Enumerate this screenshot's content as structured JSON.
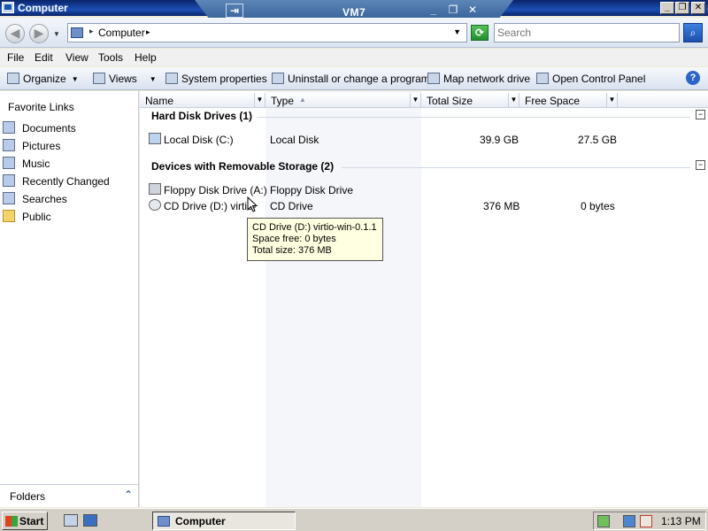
{
  "window": {
    "title": "Computer"
  },
  "vm_bar": {
    "title": "VM7",
    "pin_glyph": "⇥",
    "min_glyph": "_",
    "restore_glyph": "❐",
    "close_glyph": "✕"
  },
  "title_buttons": {
    "min": "_",
    "max": "❐",
    "close": "✕"
  },
  "nav": {
    "back_glyph": "◀",
    "forward_glyph": "▶"
  },
  "address": {
    "separator": "▸",
    "location": "Computer",
    "chevron": "▸",
    "dropdown": "▼"
  },
  "search": {
    "placeholder": "Search"
  },
  "menu": [
    "File",
    "Edit",
    "View",
    "Tools",
    "Help"
  ],
  "commands": {
    "organize": "Organize",
    "views": "Views",
    "system_properties": "System properties",
    "uninstall": "Uninstall or change a program",
    "map_drive": "Map network drive",
    "control_panel": "Open Control Panel",
    "help": "?"
  },
  "sidebar": {
    "heading": "Favorite Links",
    "items": [
      {
        "label": "Documents",
        "icon": "documents-icon"
      },
      {
        "label": "Pictures",
        "icon": "pictures-icon"
      },
      {
        "label": "Music",
        "icon": "music-icon"
      },
      {
        "label": "Recently Changed",
        "icon": "recently-changed-icon"
      },
      {
        "label": "Searches",
        "icon": "searches-icon"
      },
      {
        "label": "Public",
        "icon": "public-folder-icon"
      }
    ],
    "folders_label": "Folders",
    "folders_chevron": "⌃"
  },
  "columns": {
    "name": "Name",
    "type": "Type",
    "total_size": "Total Size",
    "free_space": "Free Space",
    "sort_glyph": "▲"
  },
  "groups": {
    "hard_disks": "Hard Disk Drives (1)",
    "removable": "Devices with Removable Storage (2)",
    "collapse_glyph": "−"
  },
  "drives": {
    "local_disk": {
      "name": "Local Disk (C:)",
      "type": "Local Disk",
      "total": "39.9 GB",
      "free": "27.5 GB"
    },
    "floppy": {
      "name": "Floppy Disk Drive (A:)",
      "type": "Floppy Disk Drive",
      "total": "",
      "free": ""
    },
    "cd": {
      "name": "CD Drive (D:) virtio-",
      "type": "CD Drive",
      "total": "376 MB",
      "free": "0 bytes"
    }
  },
  "tooltip": {
    "line1": "CD Drive (D:) virtio-win-0.1.1",
    "line2": "Space free: 0 bytes",
    "line3": "Total size: 376 MB"
  },
  "taskbar": {
    "start": "Start",
    "task_label": "Computer",
    "clock": "1:13 PM"
  }
}
